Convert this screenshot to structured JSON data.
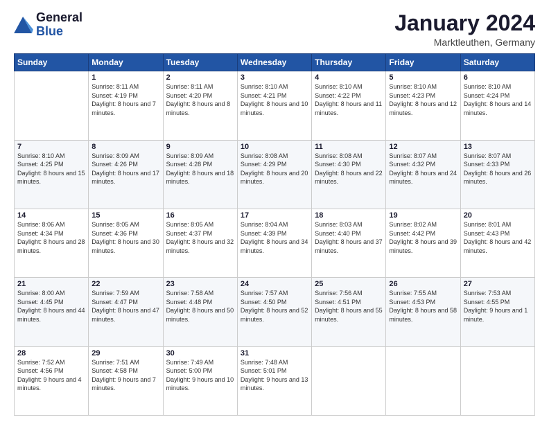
{
  "logo": {
    "line1": "General",
    "line2": "Blue"
  },
  "header": {
    "title": "January 2024",
    "subtitle": "Marktleuthen, Germany"
  },
  "weekdays": [
    "Sunday",
    "Monday",
    "Tuesday",
    "Wednesday",
    "Thursday",
    "Friday",
    "Saturday"
  ],
  "weeks": [
    [
      {
        "day": "",
        "sunrise": "",
        "sunset": "",
        "daylight": ""
      },
      {
        "day": "1",
        "sunrise": "Sunrise: 8:11 AM",
        "sunset": "Sunset: 4:19 PM",
        "daylight": "Daylight: 8 hours and 7 minutes."
      },
      {
        "day": "2",
        "sunrise": "Sunrise: 8:11 AM",
        "sunset": "Sunset: 4:20 PM",
        "daylight": "Daylight: 8 hours and 8 minutes."
      },
      {
        "day": "3",
        "sunrise": "Sunrise: 8:10 AM",
        "sunset": "Sunset: 4:21 PM",
        "daylight": "Daylight: 8 hours and 10 minutes."
      },
      {
        "day": "4",
        "sunrise": "Sunrise: 8:10 AM",
        "sunset": "Sunset: 4:22 PM",
        "daylight": "Daylight: 8 hours and 11 minutes."
      },
      {
        "day": "5",
        "sunrise": "Sunrise: 8:10 AM",
        "sunset": "Sunset: 4:23 PM",
        "daylight": "Daylight: 8 hours and 12 minutes."
      },
      {
        "day": "6",
        "sunrise": "Sunrise: 8:10 AM",
        "sunset": "Sunset: 4:24 PM",
        "daylight": "Daylight: 8 hours and 14 minutes."
      }
    ],
    [
      {
        "day": "7",
        "sunrise": "Sunrise: 8:10 AM",
        "sunset": "Sunset: 4:25 PM",
        "daylight": "Daylight: 8 hours and 15 minutes."
      },
      {
        "day": "8",
        "sunrise": "Sunrise: 8:09 AM",
        "sunset": "Sunset: 4:26 PM",
        "daylight": "Daylight: 8 hours and 17 minutes."
      },
      {
        "day": "9",
        "sunrise": "Sunrise: 8:09 AM",
        "sunset": "Sunset: 4:28 PM",
        "daylight": "Daylight: 8 hours and 18 minutes."
      },
      {
        "day": "10",
        "sunrise": "Sunrise: 8:08 AM",
        "sunset": "Sunset: 4:29 PM",
        "daylight": "Daylight: 8 hours and 20 minutes."
      },
      {
        "day": "11",
        "sunrise": "Sunrise: 8:08 AM",
        "sunset": "Sunset: 4:30 PM",
        "daylight": "Daylight: 8 hours and 22 minutes."
      },
      {
        "day": "12",
        "sunrise": "Sunrise: 8:07 AM",
        "sunset": "Sunset: 4:32 PM",
        "daylight": "Daylight: 8 hours and 24 minutes."
      },
      {
        "day": "13",
        "sunrise": "Sunrise: 8:07 AM",
        "sunset": "Sunset: 4:33 PM",
        "daylight": "Daylight: 8 hours and 26 minutes."
      }
    ],
    [
      {
        "day": "14",
        "sunrise": "Sunrise: 8:06 AM",
        "sunset": "Sunset: 4:34 PM",
        "daylight": "Daylight: 8 hours and 28 minutes."
      },
      {
        "day": "15",
        "sunrise": "Sunrise: 8:05 AM",
        "sunset": "Sunset: 4:36 PM",
        "daylight": "Daylight: 8 hours and 30 minutes."
      },
      {
        "day": "16",
        "sunrise": "Sunrise: 8:05 AM",
        "sunset": "Sunset: 4:37 PM",
        "daylight": "Daylight: 8 hours and 32 minutes."
      },
      {
        "day": "17",
        "sunrise": "Sunrise: 8:04 AM",
        "sunset": "Sunset: 4:39 PM",
        "daylight": "Daylight: 8 hours and 34 minutes."
      },
      {
        "day": "18",
        "sunrise": "Sunrise: 8:03 AM",
        "sunset": "Sunset: 4:40 PM",
        "daylight": "Daylight: 8 hours and 37 minutes."
      },
      {
        "day": "19",
        "sunrise": "Sunrise: 8:02 AM",
        "sunset": "Sunset: 4:42 PM",
        "daylight": "Daylight: 8 hours and 39 minutes."
      },
      {
        "day": "20",
        "sunrise": "Sunrise: 8:01 AM",
        "sunset": "Sunset: 4:43 PM",
        "daylight": "Daylight: 8 hours and 42 minutes."
      }
    ],
    [
      {
        "day": "21",
        "sunrise": "Sunrise: 8:00 AM",
        "sunset": "Sunset: 4:45 PM",
        "daylight": "Daylight: 8 hours and 44 minutes."
      },
      {
        "day": "22",
        "sunrise": "Sunrise: 7:59 AM",
        "sunset": "Sunset: 4:47 PM",
        "daylight": "Daylight: 8 hours and 47 minutes."
      },
      {
        "day": "23",
        "sunrise": "Sunrise: 7:58 AM",
        "sunset": "Sunset: 4:48 PM",
        "daylight": "Daylight: 8 hours and 50 minutes."
      },
      {
        "day": "24",
        "sunrise": "Sunrise: 7:57 AM",
        "sunset": "Sunset: 4:50 PM",
        "daylight": "Daylight: 8 hours and 52 minutes."
      },
      {
        "day": "25",
        "sunrise": "Sunrise: 7:56 AM",
        "sunset": "Sunset: 4:51 PM",
        "daylight": "Daylight: 8 hours and 55 minutes."
      },
      {
        "day": "26",
        "sunrise": "Sunrise: 7:55 AM",
        "sunset": "Sunset: 4:53 PM",
        "daylight": "Daylight: 8 hours and 58 minutes."
      },
      {
        "day": "27",
        "sunrise": "Sunrise: 7:53 AM",
        "sunset": "Sunset: 4:55 PM",
        "daylight": "Daylight: 9 hours and 1 minute."
      }
    ],
    [
      {
        "day": "28",
        "sunrise": "Sunrise: 7:52 AM",
        "sunset": "Sunset: 4:56 PM",
        "daylight": "Daylight: 9 hours and 4 minutes."
      },
      {
        "day": "29",
        "sunrise": "Sunrise: 7:51 AM",
        "sunset": "Sunset: 4:58 PM",
        "daylight": "Daylight: 9 hours and 7 minutes."
      },
      {
        "day": "30",
        "sunrise": "Sunrise: 7:49 AM",
        "sunset": "Sunset: 5:00 PM",
        "daylight": "Daylight: 9 hours and 10 minutes."
      },
      {
        "day": "31",
        "sunrise": "Sunrise: 7:48 AM",
        "sunset": "Sunset: 5:01 PM",
        "daylight": "Daylight: 9 hours and 13 minutes."
      },
      {
        "day": "",
        "sunrise": "",
        "sunset": "",
        "daylight": ""
      },
      {
        "day": "",
        "sunrise": "",
        "sunset": "",
        "daylight": ""
      },
      {
        "day": "",
        "sunrise": "",
        "sunset": "",
        "daylight": ""
      }
    ]
  ]
}
